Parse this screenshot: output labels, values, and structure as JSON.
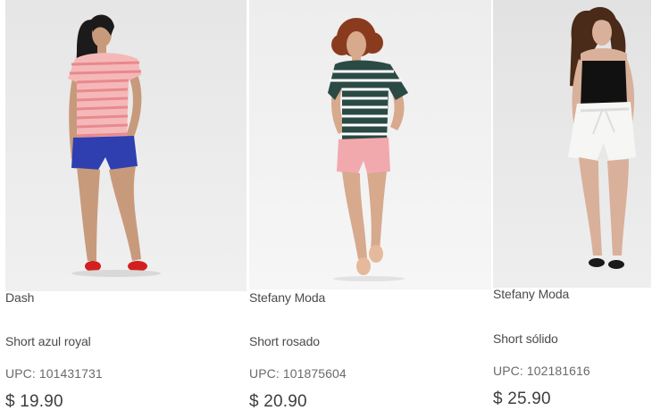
{
  "products": [
    {
      "brand": "Dash",
      "name": "Short azul royal",
      "upc": "UPC: 101431731",
      "price": "$ 19.90",
      "image_subject": "model-in-striped-tee-and-royal-blue-shorts"
    },
    {
      "brand": "Stefany Moda",
      "name": "Short rosado",
      "upc": "UPC: 101875604",
      "price": "$ 20.90",
      "image_subject": "model-in-green-striped-tee-and-pink-shorts"
    },
    {
      "brand": "Stefany Moda",
      "name": "Short sólido",
      "upc": "UPC: 102181616",
      "price": "$ 25.90",
      "image_subject": "model-in-black-top-and-white-shorts"
    }
  ],
  "colors": {
    "text": "#4a4a4a",
    "upc_text": "#6a6a6a",
    "price_text": "#3e3e3e",
    "photo_bg": "#ebebeb"
  }
}
